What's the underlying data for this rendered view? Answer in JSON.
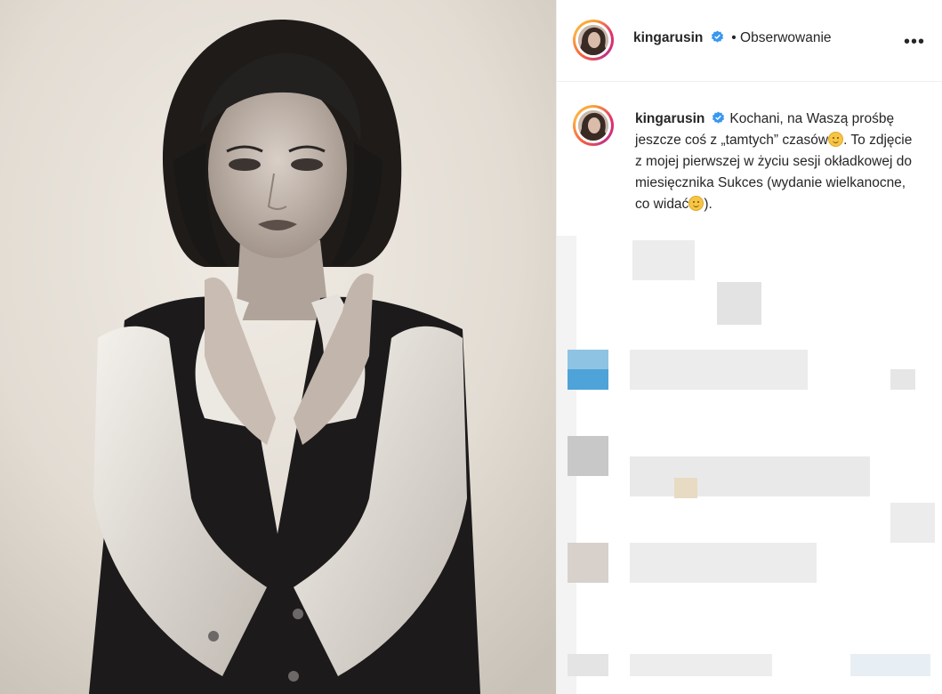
{
  "post": {
    "username": "kingarusin",
    "follow_label": "Obserwowanie",
    "more_label": "•••",
    "caption_parts": {
      "a": "Kochani, na Waszą prośbę jeszcze coś z „tamtych” czasów",
      "b": ". To zdjęcie z mojej pierwszej w życiu sesji okładkowej do miesięcznika Sukces (wydanie wielkanocne, co widać",
      "c": ")."
    }
  },
  "colors": {
    "verified_blue": "#3897f0",
    "text": "#262626",
    "divider": "#efefef"
  },
  "icons": [
    "verified-badge-icon",
    "smiling-emoji-icon",
    "winking-emoji-icon",
    "more-options-icon"
  ]
}
